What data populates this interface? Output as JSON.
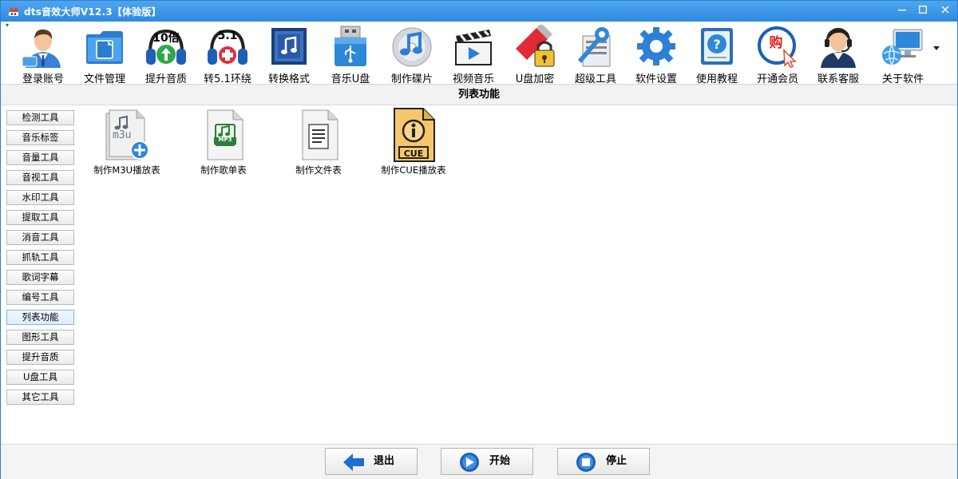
{
  "window": {
    "title": "dts音效大师V12.3【体验版】"
  },
  "toolbar": {
    "items": [
      {
        "label": "登录账号",
        "icon": "user-login-icon"
      },
      {
        "label": "文件管理",
        "icon": "folder-icon"
      },
      {
        "label": "提升音质",
        "icon": "headphones-10x-icon"
      },
      {
        "label": "转5.1环绕",
        "icon": "headphones-51-icon"
      },
      {
        "label": "转换格式",
        "icon": "music-convert-icon"
      },
      {
        "label": "音乐U盘",
        "icon": "usb-drive-icon"
      },
      {
        "label": "制作碟片",
        "icon": "disc-icon"
      },
      {
        "label": "视频音乐",
        "icon": "clapperboard-icon"
      },
      {
        "label": "U盘加密",
        "icon": "usb-lock-icon"
      },
      {
        "label": "超级工具",
        "icon": "tools-icon"
      },
      {
        "label": "软件设置",
        "icon": "gear-icon"
      },
      {
        "label": "使用教程",
        "icon": "help-book-icon"
      },
      {
        "label": "开通会员",
        "icon": "buy-member-icon"
      },
      {
        "label": "联系客服",
        "icon": "support-agent-icon"
      },
      {
        "label": "关于软件",
        "icon": "computer-globe-icon"
      }
    ],
    "badges": {
      "quality": "10倍",
      "surround": "5.1",
      "buy": "购"
    }
  },
  "section": {
    "title": "列表功能"
  },
  "sidebar": {
    "items": [
      {
        "label": "检测工具"
      },
      {
        "label": "音乐标签"
      },
      {
        "label": "音量工具"
      },
      {
        "label": "音视工具"
      },
      {
        "label": "水印工具"
      },
      {
        "label": "提取工具"
      },
      {
        "label": "消音工具"
      },
      {
        "label": "抓轨工具"
      },
      {
        "label": "歌词字幕"
      },
      {
        "label": "编号工具"
      },
      {
        "label": "列表功能",
        "active": true
      },
      {
        "label": "图形工具"
      },
      {
        "label": "提升音质"
      },
      {
        "label": "U盘工具"
      },
      {
        "label": "其它工具"
      }
    ]
  },
  "features": [
    {
      "label": "制作M3U播放表",
      "icon": "m3u-file-icon",
      "badge": "m3u"
    },
    {
      "label": "制作歌单表",
      "icon": "mp3-file-icon",
      "badge": "MP3"
    },
    {
      "label": "制作文件表",
      "icon": "text-file-icon"
    },
    {
      "label": "制作CUE播放表",
      "icon": "cue-file-icon",
      "badge": "CUE"
    }
  ],
  "footer": {
    "exit_label": "退出",
    "start_label": "开始",
    "stop_label": "停止"
  },
  "colors": {
    "titlebar": "#2f8ae0",
    "accent": "#1e6fc8",
    "cue_file": "#f5c66a"
  }
}
